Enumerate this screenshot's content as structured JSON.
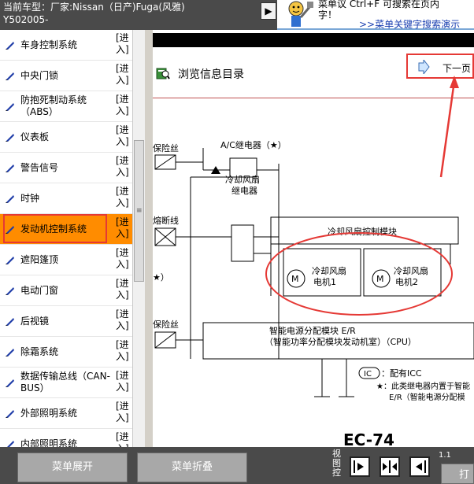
{
  "header": {
    "car_line1": "当前车型：厂家:Nissan（日产)Fuga(风雅)",
    "car_line2": "Y502005-"
  },
  "ad": {
    "text_line1": "菜单议 Ctrl+F 可搜索在页内",
    "text_line2": "字！",
    "link": ">>菜单关键字搜索演示"
  },
  "sidebar": {
    "enter_label": "[进入]",
    "items": [
      {
        "label": "车身控制系统"
      },
      {
        "label": "中央门锁"
      },
      {
        "label": "防抱死制动系统（ABS）"
      },
      {
        "label": "仪表板"
      },
      {
        "label": "警告信号"
      },
      {
        "label": "时钟"
      },
      {
        "label": "发动机控制系统"
      },
      {
        "label": "遮阳篷顶"
      },
      {
        "label": "电动门窗"
      },
      {
        "label": "后视镜"
      },
      {
        "label": "除霜系统"
      },
      {
        "label": "数据传输总线（CAN-BUS）"
      },
      {
        "label": "外部照明系统"
      },
      {
        "label": "内部照明系统"
      }
    ],
    "selected_index": 6
  },
  "content": {
    "title": "浏览信息目录",
    "next_label": "下一页",
    "diagram": {
      "fuse1": "保险丝",
      "ac_relay": "A/C继电器（★）",
      "fusible_link": "熔断线",
      "fan_relay_line1": "冷却风扇",
      "fan_relay_line2": "继电器",
      "module": "冷却风扇控制模块",
      "motor1_line1": "冷却风扇",
      "motor1_line2": "电机1",
      "motor2_line1": "冷却风扇",
      "motor2_line2": "电机2",
      "star": "★）",
      "fuse2": "保险丝",
      "ipdm_line1": "智能电源分配模块 E/R",
      "ipdm_line2": "（智能功率分配模块发动机室）（CPU）",
      "ic_badge": "IC",
      "ic_note": "：配有ICC",
      "note2_line1": "★：此类继电器内置于智能",
      "note2_line2": "E/R（智能电源分配模",
      "page_code": "EC-74",
      "motor_symbol": "M"
    }
  },
  "footer": {
    "expand_label": "菜单展开",
    "collapse_label": "菜单折叠",
    "view_label": "视图控",
    "page_info": "1.1",
    "right_button_label": "打"
  },
  "colors": {
    "highlight": "#ff8c00",
    "annotation_red": "#e53935",
    "chrome_dark": "#4a4a4a",
    "sidebar_icon": "#1e3ca8"
  }
}
